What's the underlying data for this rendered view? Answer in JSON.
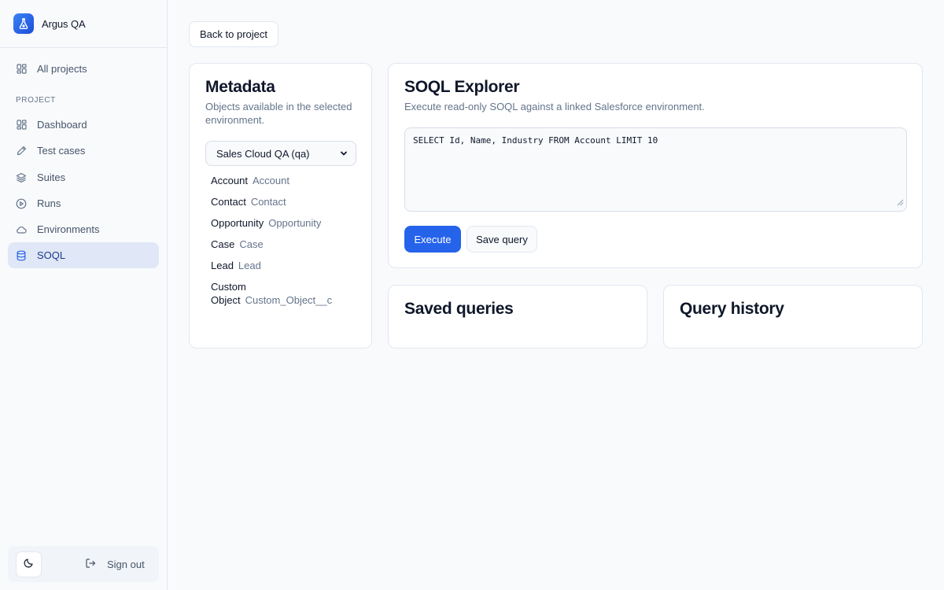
{
  "app": {
    "name": "Argus QA"
  },
  "sidebar": {
    "all_projects": "All projects",
    "section_label": "PROJECT",
    "items": [
      {
        "label": "Dashboard",
        "icon": "grid-icon"
      },
      {
        "label": "Test cases",
        "icon": "pencil-icon"
      },
      {
        "label": "Suites",
        "icon": "layers-icon"
      },
      {
        "label": "Runs",
        "icon": "play-circle-icon"
      },
      {
        "label": "Environments",
        "icon": "cloud-icon"
      },
      {
        "label": "SOQL",
        "icon": "database-icon",
        "active": true
      }
    ],
    "sign_out": "Sign out"
  },
  "toolbar": {
    "back_label": "Back to project"
  },
  "metadata": {
    "title": "Metadata",
    "subtitle_line1": "Objects available in the selected",
    "subtitle_line2": "environment.",
    "environment_selected": "Sales Cloud QA (qa)",
    "objects": [
      {
        "label": "Account",
        "api_name": "Account"
      },
      {
        "label": "Contact",
        "api_name": "Contact"
      },
      {
        "label": "Opportunity",
        "api_name": "Opportunity"
      },
      {
        "label": "Case",
        "api_name": "Case"
      },
      {
        "label": "Lead",
        "api_name": "Lead"
      },
      {
        "label_line1": "Custom",
        "label_line2": "Object",
        "api_name": "Custom_Object__c"
      }
    ]
  },
  "explorer": {
    "title": "SOQL Explorer",
    "subtitle": "Execute read-only SOQL against a linked Salesforce environment.",
    "query": "SELECT Id, Name, Industry FROM Account LIMIT 10",
    "execute_label": "Execute",
    "save_label": "Save query"
  },
  "saved_queries": {
    "title": "Saved queries"
  },
  "query_history": {
    "title": "Query history"
  },
  "colors": {
    "accent": "#2563eb",
    "active_nav_bg": "#e0e7f6",
    "border": "#e2e8f0"
  }
}
